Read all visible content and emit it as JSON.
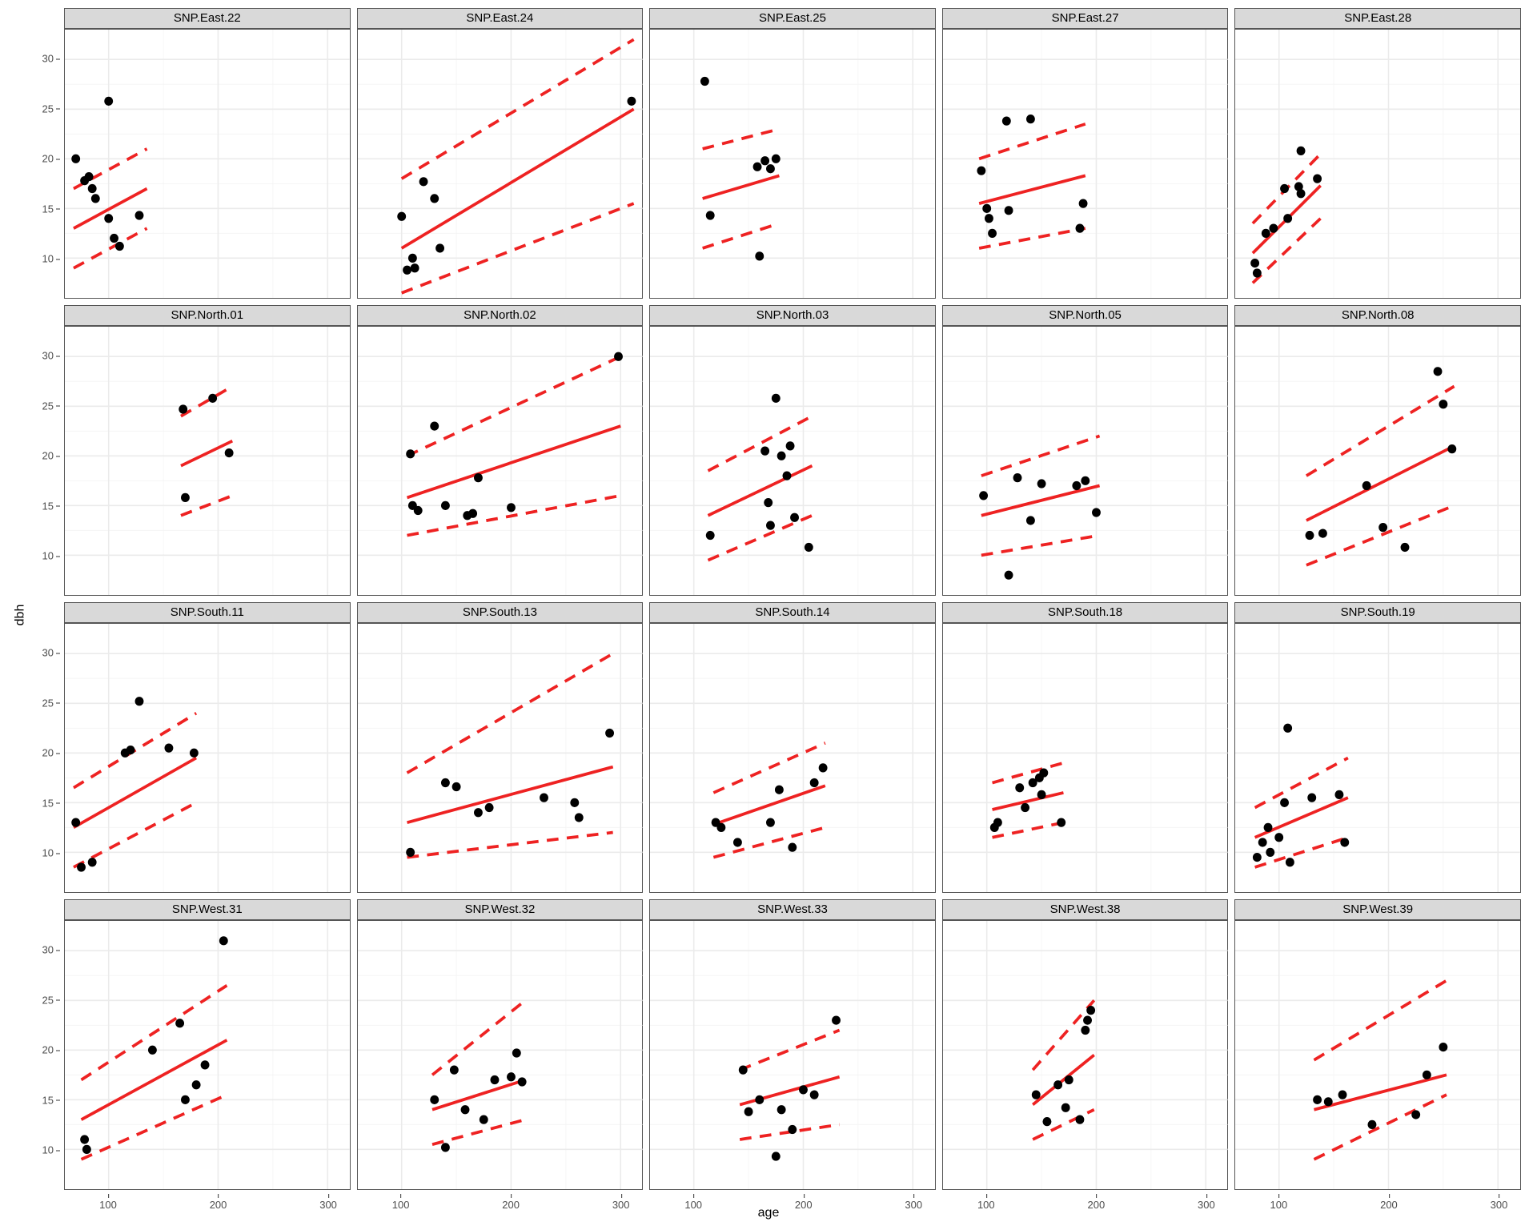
{
  "xlabel": "age",
  "ylabel": "dbh",
  "x_ticks": [
    100,
    200,
    300
  ],
  "y_ticks": [
    10,
    15,
    20,
    25,
    30
  ],
  "chart_data": {
    "type": "scatter",
    "xlabel": "age",
    "ylabel": "dbh",
    "x_range": [
      60,
      320
    ],
    "y_range": [
      6,
      33
    ],
    "facets": [
      {
        "name": "SNP.East.22",
        "points": [
          {
            "x": 70,
            "y": 20.0
          },
          {
            "x": 78,
            "y": 17.8
          },
          {
            "x": 82,
            "y": 18.2
          },
          {
            "x": 85,
            "y": 17.0
          },
          {
            "x": 88,
            "y": 16.0
          },
          {
            "x": 100,
            "y": 25.8
          },
          {
            "x": 100,
            "y": 14.0
          },
          {
            "x": 105,
            "y": 12.0
          },
          {
            "x": 110,
            "y": 11.2
          },
          {
            "x": 128,
            "y": 14.3
          }
        ],
        "fit": {
          "x1": 68,
          "y1": 13.0,
          "x2": 135,
          "y2": 17.0
        },
        "ci": {
          "lo1": 9.0,
          "hi1": 17.0,
          "lo2": 13.0,
          "hi2": 21.0
        }
      },
      {
        "name": "SNP.East.24",
        "points": [
          {
            "x": 100,
            "y": 14.2
          },
          {
            "x": 105,
            "y": 8.8
          },
          {
            "x": 110,
            "y": 10.0
          },
          {
            "x": 112,
            "y": 9.0
          },
          {
            "x": 120,
            "y": 17.7
          },
          {
            "x": 130,
            "y": 16.0
          },
          {
            "x": 135,
            "y": 11.0
          },
          {
            "x": 310,
            "y": 25.8
          }
        ],
        "fit": {
          "x1": 100,
          "y1": 11.0,
          "x2": 312,
          "y2": 25.0
        },
        "ci": {
          "lo1": 6.5,
          "hi1": 18.0,
          "lo2": 15.5,
          "hi2": 32.0
        }
      },
      {
        "name": "SNP.East.25",
        "points": [
          {
            "x": 110,
            "y": 27.8
          },
          {
            "x": 115,
            "y": 14.3
          },
          {
            "x": 158,
            "y": 19.2
          },
          {
            "x": 160,
            "y": 10.2
          },
          {
            "x": 165,
            "y": 19.8
          },
          {
            "x": 170,
            "y": 19.0
          },
          {
            "x": 175,
            "y": 20.0
          }
        ],
        "fit": {
          "x1": 108,
          "y1": 16.0,
          "x2": 178,
          "y2": 18.3
        },
        "ci": {
          "lo1": 11.0,
          "hi1": 21.0,
          "lo2": 13.5,
          "hi2": 23.0
        }
      },
      {
        "name": "SNP.East.27",
        "points": [
          {
            "x": 95,
            "y": 18.8
          },
          {
            "x": 100,
            "y": 15.0
          },
          {
            "x": 102,
            "y": 14.0
          },
          {
            "x": 105,
            "y": 12.5
          },
          {
            "x": 118,
            "y": 23.8
          },
          {
            "x": 120,
            "y": 14.8
          },
          {
            "x": 140,
            "y": 24.0
          },
          {
            "x": 185,
            "y": 13.0
          },
          {
            "x": 188,
            "y": 15.5
          }
        ],
        "fit": {
          "x1": 93,
          "y1": 15.5,
          "x2": 190,
          "y2": 18.3
        },
        "ci": {
          "lo1": 11.0,
          "hi1": 20.0,
          "lo2": 13.0,
          "hi2": 23.5
        }
      },
      {
        "name": "SNP.East.28",
        "points": [
          {
            "x": 78,
            "y": 9.5
          },
          {
            "x": 80,
            "y": 8.5
          },
          {
            "x": 88,
            "y": 12.5
          },
          {
            "x": 95,
            "y": 13.0
          },
          {
            "x": 105,
            "y": 17.0
          },
          {
            "x": 108,
            "y": 14.0
          },
          {
            "x": 118,
            "y": 17.2
          },
          {
            "x": 120,
            "y": 16.5
          },
          {
            "x": 120,
            "y": 20.8
          },
          {
            "x": 135,
            "y": 18.0
          }
        ],
        "fit": {
          "x1": 76,
          "y1": 10.5,
          "x2": 138,
          "y2": 17.3
        },
        "ci": {
          "lo1": 7.5,
          "hi1": 13.5,
          "lo2": 14.0,
          "hi2": 20.5
        }
      },
      {
        "name": "SNP.North.01",
        "points": [
          {
            "x": 168,
            "y": 24.7
          },
          {
            "x": 170,
            "y": 15.8
          },
          {
            "x": 195,
            "y": 25.8
          },
          {
            "x": 210,
            "y": 20.3
          }
        ],
        "fit": {
          "x1": 166,
          "y1": 19.0,
          "x2": 213,
          "y2": 21.5
        },
        "ci": {
          "lo1": 14.0,
          "hi1": 24.0,
          "lo2": 16.0,
          "hi2": 27.0
        }
      },
      {
        "name": "SNP.North.02",
        "points": [
          {
            "x": 108,
            "y": 20.2
          },
          {
            "x": 110,
            "y": 15.0
          },
          {
            "x": 115,
            "y": 14.5
          },
          {
            "x": 130,
            "y": 23.0
          },
          {
            "x": 140,
            "y": 15.0
          },
          {
            "x": 160,
            "y": 14.0
          },
          {
            "x": 165,
            "y": 14.2
          },
          {
            "x": 170,
            "y": 17.8
          },
          {
            "x": 200,
            "y": 14.8
          },
          {
            "x": 298,
            "y": 30.0
          }
        ],
        "fit": {
          "x1": 105,
          "y1": 15.8,
          "x2": 300,
          "y2": 23.0
        },
        "ci": {
          "lo1": 12.0,
          "hi1": 20.0,
          "lo2": 16.0,
          "hi2": 30.0
        }
      },
      {
        "name": "SNP.North.03",
        "points": [
          {
            "x": 115,
            "y": 12.0
          },
          {
            "x": 165,
            "y": 20.5
          },
          {
            "x": 168,
            "y": 15.3
          },
          {
            "x": 170,
            "y": 13.0
          },
          {
            "x": 175,
            "y": 25.8
          },
          {
            "x": 180,
            "y": 20.0
          },
          {
            "x": 185,
            "y": 18.0
          },
          {
            "x": 188,
            "y": 21.0
          },
          {
            "x": 192,
            "y": 13.8
          },
          {
            "x": 205,
            "y": 10.8
          }
        ],
        "fit": {
          "x1": 113,
          "y1": 14.0,
          "x2": 208,
          "y2": 19.0
        },
        "ci": {
          "lo1": 9.5,
          "hi1": 18.5,
          "lo2": 14.0,
          "hi2": 24.0
        }
      },
      {
        "name": "SNP.North.05",
        "points": [
          {
            "x": 97,
            "y": 16.0
          },
          {
            "x": 120,
            "y": 8.0
          },
          {
            "x": 128,
            "y": 17.8
          },
          {
            "x": 140,
            "y": 13.5
          },
          {
            "x": 150,
            "y": 17.2
          },
          {
            "x": 182,
            "y": 17.0
          },
          {
            "x": 190,
            "y": 17.5
          },
          {
            "x": 200,
            "y": 14.3
          }
        ],
        "fit": {
          "x1": 95,
          "y1": 14.0,
          "x2": 203,
          "y2": 17.0
        },
        "ci": {
          "lo1": 10.0,
          "hi1": 18.0,
          "lo2": 12.0,
          "hi2": 22.0
        }
      },
      {
        "name": "SNP.North.08",
        "points": [
          {
            "x": 128,
            "y": 12.0
          },
          {
            "x": 140,
            "y": 12.2
          },
          {
            "x": 180,
            "y": 17.0
          },
          {
            "x": 195,
            "y": 12.8
          },
          {
            "x": 215,
            "y": 10.8
          },
          {
            "x": 245,
            "y": 28.5
          },
          {
            "x": 250,
            "y": 25.2
          },
          {
            "x": 258,
            "y": 20.7
          }
        ],
        "fit": {
          "x1": 125,
          "y1": 13.5,
          "x2": 260,
          "y2": 21.0
        },
        "ci": {
          "lo1": 9.0,
          "hi1": 18.0,
          "lo2": 15.0,
          "hi2": 27.0
        }
      },
      {
        "name": "SNP.South.11",
        "points": [
          {
            "x": 70,
            "y": 13.0
          },
          {
            "x": 75,
            "y": 8.5
          },
          {
            "x": 85,
            "y": 9.0
          },
          {
            "x": 115,
            "y": 20.0
          },
          {
            "x": 120,
            "y": 20.3
          },
          {
            "x": 128,
            "y": 25.2
          },
          {
            "x": 155,
            "y": 20.5
          },
          {
            "x": 178,
            "y": 20.0
          }
        ],
        "fit": {
          "x1": 68,
          "y1": 12.5,
          "x2": 180,
          "y2": 19.5
        },
        "ci": {
          "lo1": 8.5,
          "hi1": 16.5,
          "lo2": 15.0,
          "hi2": 24.0
        }
      },
      {
        "name": "SNP.South.13",
        "points": [
          {
            "x": 108,
            "y": 10.0
          },
          {
            "x": 140,
            "y": 17.0
          },
          {
            "x": 150,
            "y": 16.6
          },
          {
            "x": 170,
            "y": 14.0
          },
          {
            "x": 180,
            "y": 14.5
          },
          {
            "x": 230,
            "y": 15.5
          },
          {
            "x": 258,
            "y": 15.0
          },
          {
            "x": 262,
            "y": 13.5
          },
          {
            "x": 290,
            "y": 22.0
          }
        ],
        "fit": {
          "x1": 105,
          "y1": 13.0,
          "x2": 293,
          "y2": 18.6
        },
        "ci": {
          "lo1": 9.5,
          "hi1": 18.0,
          "lo2": 12.0,
          "hi2": 30.0
        }
      },
      {
        "name": "SNP.South.14",
        "points": [
          {
            "x": 120,
            "y": 13.0
          },
          {
            "x": 125,
            "y": 12.5
          },
          {
            "x": 140,
            "y": 11.0
          },
          {
            "x": 170,
            "y": 13.0
          },
          {
            "x": 178,
            "y": 16.3
          },
          {
            "x": 190,
            "y": 10.5
          },
          {
            "x": 210,
            "y": 17.0
          },
          {
            "x": 218,
            "y": 18.5
          }
        ],
        "fit": {
          "x1": 118,
          "y1": 12.8,
          "x2": 220,
          "y2": 16.7
        },
        "ci": {
          "lo1": 9.5,
          "hi1": 16.0,
          "lo2": 12.5,
          "hi2": 21.0
        }
      },
      {
        "name": "SNP.South.18",
        "points": [
          {
            "x": 107,
            "y": 12.5
          },
          {
            "x": 110,
            "y": 13.0
          },
          {
            "x": 130,
            "y": 16.5
          },
          {
            "x": 135,
            "y": 14.5
          },
          {
            "x": 142,
            "y": 17.0
          },
          {
            "x": 148,
            "y": 17.5
          },
          {
            "x": 150,
            "y": 15.8
          },
          {
            "x": 152,
            "y": 18.0
          },
          {
            "x": 168,
            "y": 13.0
          }
        ],
        "fit": {
          "x1": 105,
          "y1": 14.3,
          "x2": 170,
          "y2": 16.0
        },
        "ci": {
          "lo1": 11.5,
          "hi1": 17.0,
          "lo2": 13.0,
          "hi2": 19.0
        }
      },
      {
        "name": "SNP.South.19",
        "points": [
          {
            "x": 80,
            "y": 9.5
          },
          {
            "x": 85,
            "y": 11.0
          },
          {
            "x": 90,
            "y": 12.5
          },
          {
            "x": 92,
            "y": 10.0
          },
          {
            "x": 100,
            "y": 11.5
          },
          {
            "x": 105,
            "y": 15.0
          },
          {
            "x": 108,
            "y": 22.5
          },
          {
            "x": 110,
            "y": 9.0
          },
          {
            "x": 130,
            "y": 15.5
          },
          {
            "x": 155,
            "y": 15.8
          },
          {
            "x": 160,
            "y": 11.0
          }
        ],
        "fit": {
          "x1": 78,
          "y1": 11.5,
          "x2": 163,
          "y2": 15.5
        },
        "ci": {
          "lo1": 8.5,
          "hi1": 14.5,
          "lo2": 11.5,
          "hi2": 19.5
        }
      },
      {
        "name": "SNP.West.31",
        "points": [
          {
            "x": 78,
            "y": 11.0
          },
          {
            "x": 80,
            "y": 10.0
          },
          {
            "x": 140,
            "y": 20.0
          },
          {
            "x": 165,
            "y": 22.7
          },
          {
            "x": 170,
            "y": 15.0
          },
          {
            "x": 180,
            "y": 16.5
          },
          {
            "x": 188,
            "y": 18.5
          },
          {
            "x": 205,
            "y": 31.0
          }
        ],
        "fit": {
          "x1": 75,
          "y1": 13.0,
          "x2": 208,
          "y2": 21.0
        },
        "ci": {
          "lo1": 9.0,
          "hi1": 17.0,
          "lo2": 15.5,
          "hi2": 26.5
        }
      },
      {
        "name": "SNP.West.32",
        "points": [
          {
            "x": 130,
            "y": 15.0
          },
          {
            "x": 140,
            "y": 10.2
          },
          {
            "x": 148,
            "y": 18.0
          },
          {
            "x": 158,
            "y": 14.0
          },
          {
            "x": 175,
            "y": 13.0
          },
          {
            "x": 185,
            "y": 17.0
          },
          {
            "x": 200,
            "y": 17.3
          },
          {
            "x": 205,
            "y": 19.7
          },
          {
            "x": 210,
            "y": 16.8
          }
        ],
        "fit": {
          "x1": 128,
          "y1": 14.0,
          "x2": 213,
          "y2": 17.0
        },
        "ci": {
          "lo1": 10.5,
          "hi1": 17.5,
          "lo2": 13.0,
          "hi2": 25.0
        }
      },
      {
        "name": "SNP.West.33",
        "points": [
          {
            "x": 145,
            "y": 18.0
          },
          {
            "x": 150,
            "y": 13.8
          },
          {
            "x": 160,
            "y": 15.0
          },
          {
            "x": 175,
            "y": 9.3
          },
          {
            "x": 180,
            "y": 14.0
          },
          {
            "x": 190,
            "y": 12.0
          },
          {
            "x": 200,
            "y": 16.0
          },
          {
            "x": 210,
            "y": 15.5
          },
          {
            "x": 230,
            "y": 23.0
          }
        ],
        "fit": {
          "x1": 142,
          "y1": 14.5,
          "x2": 233,
          "y2": 17.3
        },
        "ci": {
          "lo1": 11.0,
          "hi1": 18.0,
          "lo2": 12.5,
          "hi2": 22.0
        }
      },
      {
        "name": "SNP.West.38",
        "points": [
          {
            "x": 145,
            "y": 15.5
          },
          {
            "x": 155,
            "y": 12.8
          },
          {
            "x": 165,
            "y": 16.5
          },
          {
            "x": 172,
            "y": 14.2
          },
          {
            "x": 175,
            "y": 17.0
          },
          {
            "x": 185,
            "y": 13.0
          },
          {
            "x": 190,
            "y": 22.0
          },
          {
            "x": 192,
            "y": 23.0
          },
          {
            "x": 195,
            "y": 24.0
          }
        ],
        "fit": {
          "x1": 142,
          "y1": 14.5,
          "x2": 198,
          "y2": 19.5
        },
        "ci": {
          "lo1": 11.0,
          "hi1": 18.0,
          "lo2": 14.0,
          "hi2": 25.0
        }
      },
      {
        "name": "SNP.West.39",
        "points": [
          {
            "x": 135,
            "y": 15.0
          },
          {
            "x": 145,
            "y": 14.8
          },
          {
            "x": 158,
            "y": 15.5
          },
          {
            "x": 185,
            "y": 12.5
          },
          {
            "x": 225,
            "y": 13.5
          },
          {
            "x": 235,
            "y": 17.5
          },
          {
            "x": 250,
            "y": 20.3
          }
        ],
        "fit": {
          "x1": 132,
          "y1": 14.0,
          "x2": 253,
          "y2": 17.5
        },
        "ci": {
          "lo1": 9.0,
          "hi1": 19.0,
          "lo2": 15.5,
          "hi2": 27.0
        }
      }
    ]
  }
}
